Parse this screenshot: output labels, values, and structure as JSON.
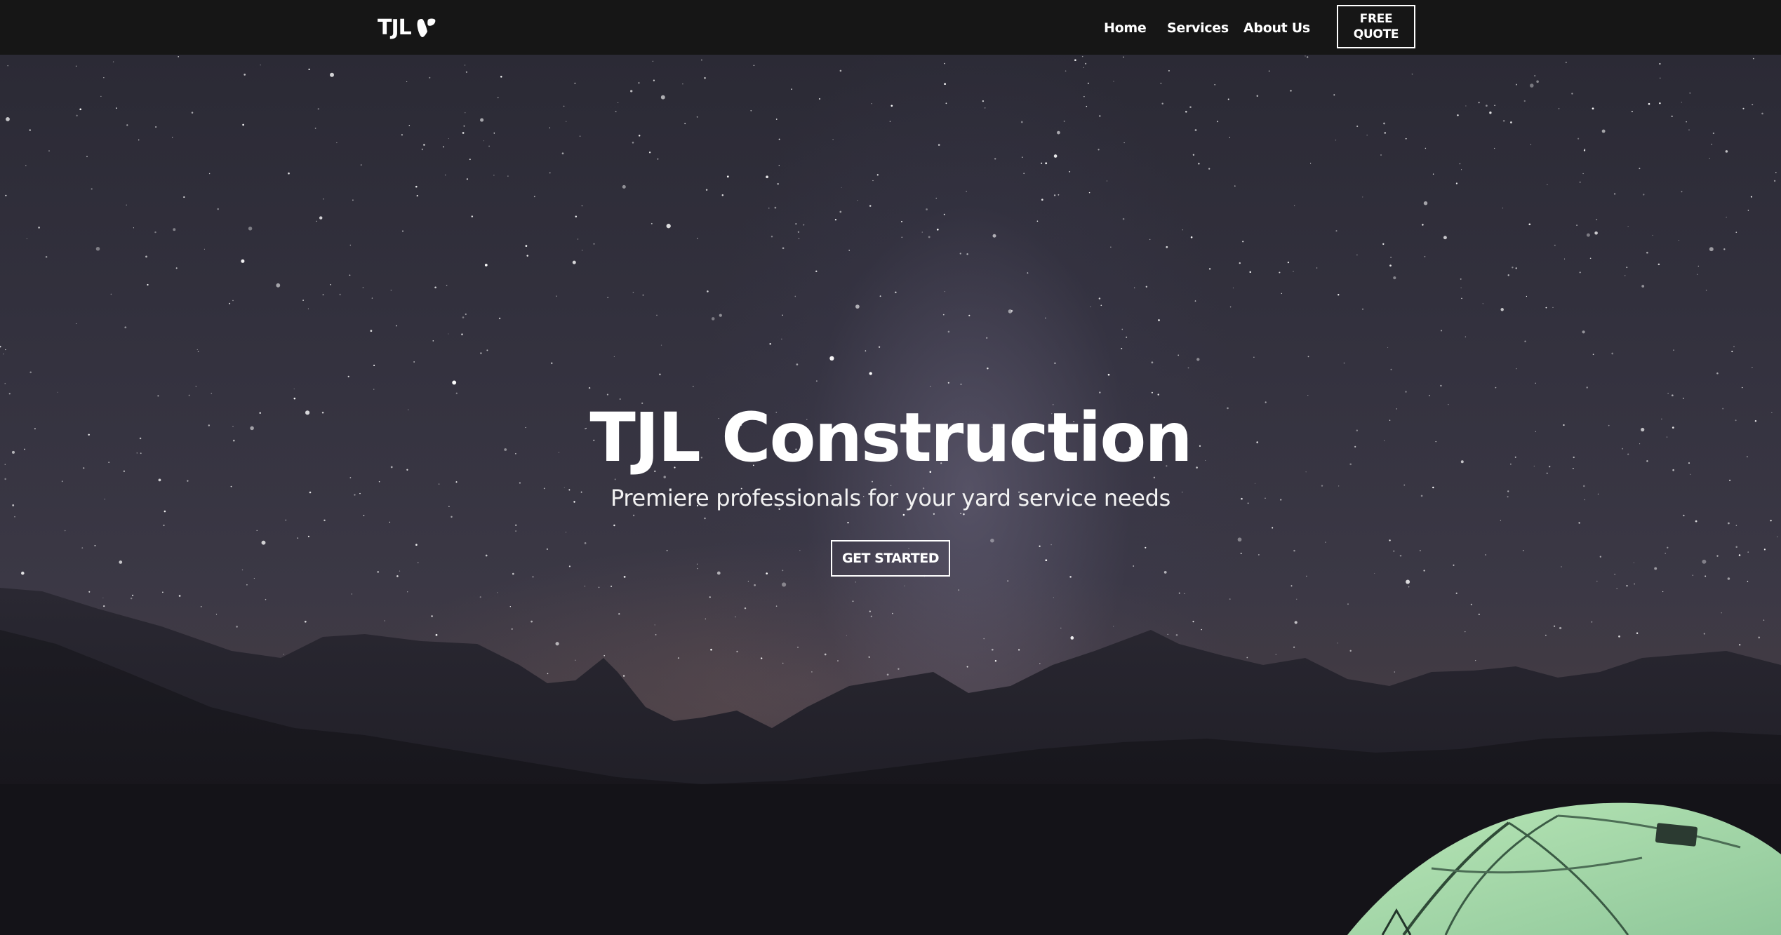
{
  "header": {
    "brand": "TJL",
    "brand_icon": "typo3-logo-icon",
    "nav": [
      {
        "label": "Home"
      },
      {
        "label": "Services"
      },
      {
        "label": "About Us"
      }
    ],
    "cta_label": "FREE QUOTE"
  },
  "hero": {
    "title": "TJL Construction",
    "subtitle": "Premiere professionals for your yard service needs",
    "button_label": "GET STARTED",
    "background": "night-sky-milky-way-mountains-tent"
  },
  "colors": {
    "navbar_bg": "#161616",
    "text": "#ffffff",
    "sky_top": "#2b2a35",
    "mountains": "#1c1b22",
    "tent": "#a7d9a9"
  }
}
